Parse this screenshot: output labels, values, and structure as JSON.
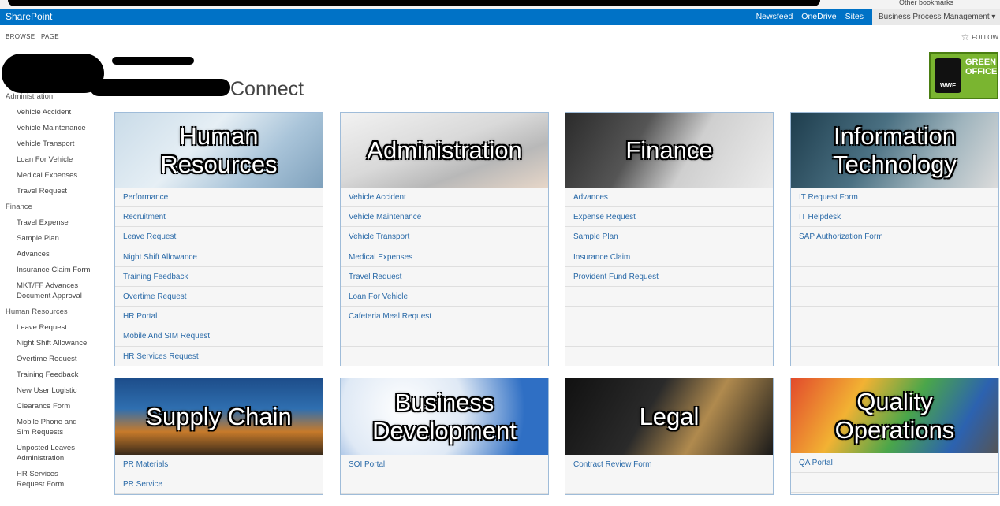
{
  "browser": {
    "bookmarks": [
      "Other bookmarks"
    ]
  },
  "suitebar": {
    "brand": "SharePoint",
    "links": [
      "Newsfeed",
      "OneDrive",
      "Sites"
    ],
    "site_menu": "Business Process Management ▾"
  },
  "ribbon": {
    "tabs": [
      "BROWSE",
      "PAGE"
    ],
    "follow": "FOLLOW"
  },
  "page": {
    "title": "Connect"
  },
  "green_office": {
    "line1": "GREEN",
    "line2": "OFFICE",
    "badge": "WWF"
  },
  "leftnav": [
    {
      "section": "Administration",
      "items": [
        "Vehicle Accident",
        "Vehicle Maintenance",
        "Vehicle Transport",
        "Loan For Vehicle",
        "Medical Expenses",
        "Travel Request"
      ]
    },
    {
      "section": "Finance",
      "items": [
        "Travel Expense",
        "Sample Plan",
        "Advances",
        "Insurance Claim Form",
        "MKT/FF Advances Document Approval"
      ]
    },
    {
      "section": "Human Resources",
      "items": [
        "Leave Request",
        "Night Shift Allowance",
        "Overtime Request",
        "Training Feedback",
        "New User Logistic",
        "Clearance Form",
        "Mobile Phone and Sim Requests",
        "Unposted Leaves Administration",
        "HR Services Request Form"
      ]
    }
  ],
  "tiles": [
    {
      "title": "Human Resources",
      "links": [
        "Performance",
        "Recruitment",
        "Leave Request",
        "Night Shift Allowance",
        "Training Feedback",
        "Overtime Request",
        "HR Portal",
        "Mobile And SIM Request",
        "HR Services Request"
      ]
    },
    {
      "title": "Administration",
      "links": [
        "Vehicle Accident",
        "Vehicle Maintenance",
        "Vehicle Transport",
        "Medical Expenses",
        "Travel Request",
        "Loan For Vehicle",
        "Cafeteria Meal Request"
      ]
    },
    {
      "title": "Finance",
      "links": [
        "Advances",
        "Expense Request",
        "Sample Plan",
        "Insurance Claim",
        "Provident Fund Request"
      ]
    },
    {
      "title": "Information Technology",
      "links": [
        "IT Request Form",
        "IT Helpdesk",
        "SAP Authorization Form"
      ]
    },
    {
      "title": "Supply Chain",
      "links": [
        "PR Materials",
        "PR Service"
      ]
    },
    {
      "title": "Business Development",
      "links": [
        "SOI Portal"
      ]
    },
    {
      "title": "Legal",
      "links": [
        "Contract Review Form"
      ]
    },
    {
      "title": "Quality Operations",
      "links": [
        "QA Portal"
      ]
    }
  ]
}
